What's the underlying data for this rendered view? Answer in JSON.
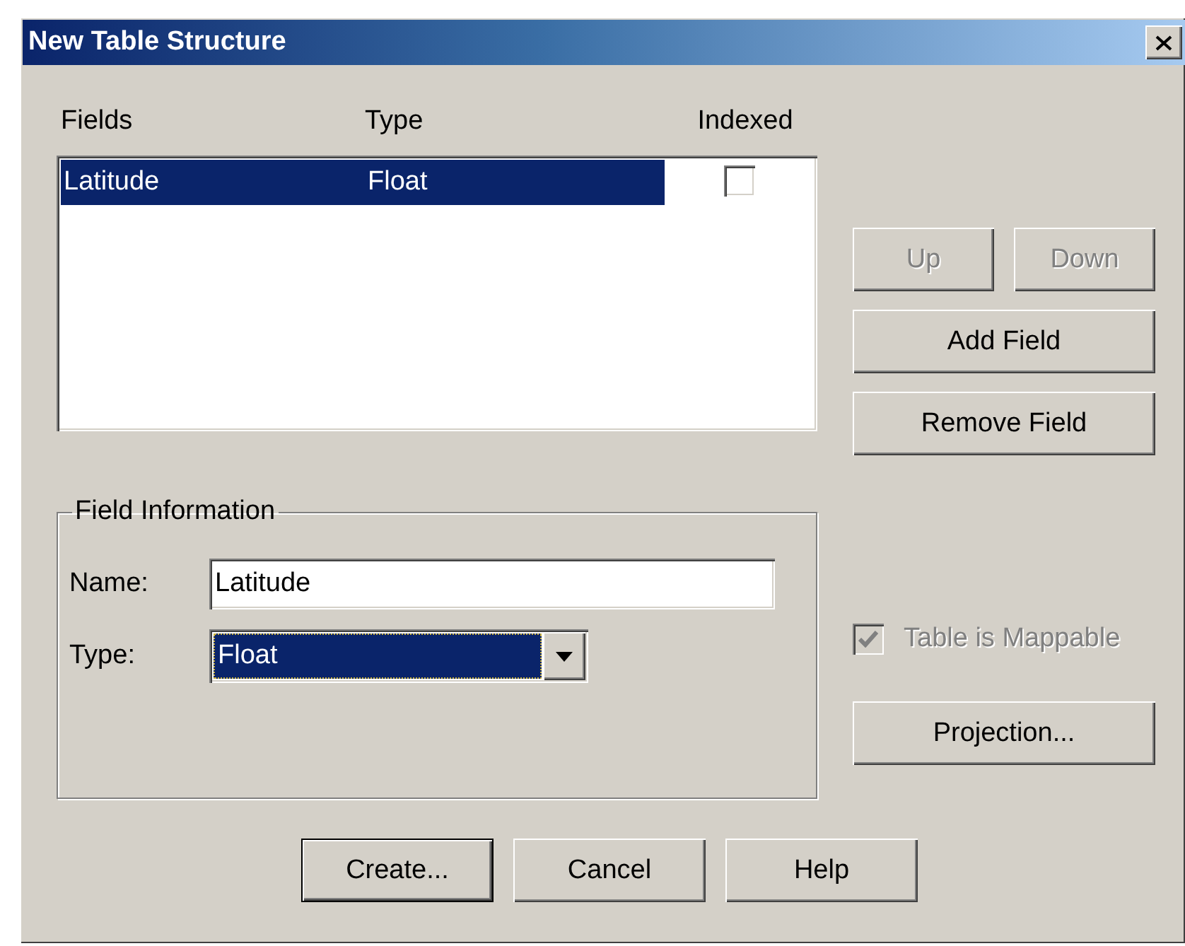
{
  "window": {
    "title": "New Table Structure"
  },
  "columns": [
    "Fields",
    "Type",
    "Indexed"
  ],
  "rows": [
    {
      "field": "Latitude",
      "type": "Float",
      "indexed": false,
      "selected": true
    }
  ],
  "side_buttons": [
    {
      "label": "Up",
      "disabled": true
    },
    {
      "label": "Down",
      "disabled": true
    },
    {
      "label": "Add Field",
      "disabled": false
    },
    {
      "label": "Remove Field",
      "disabled": false
    }
  ],
  "field_information": {
    "title": "Field Information",
    "name_label": "Name:",
    "name_value": "Latitude",
    "type_label": "Type:",
    "type_value": "Float"
  },
  "mappable": {
    "label": "Table is Mappable",
    "checked": true,
    "disabled": true
  },
  "projection_button": {
    "label": "Projection...",
    "disabled": false
  },
  "buttons": [
    {
      "label": "Create...",
      "default": true
    },
    {
      "label": "Cancel",
      "default": false
    },
    {
      "label": "Help",
      "default": false
    }
  ]
}
